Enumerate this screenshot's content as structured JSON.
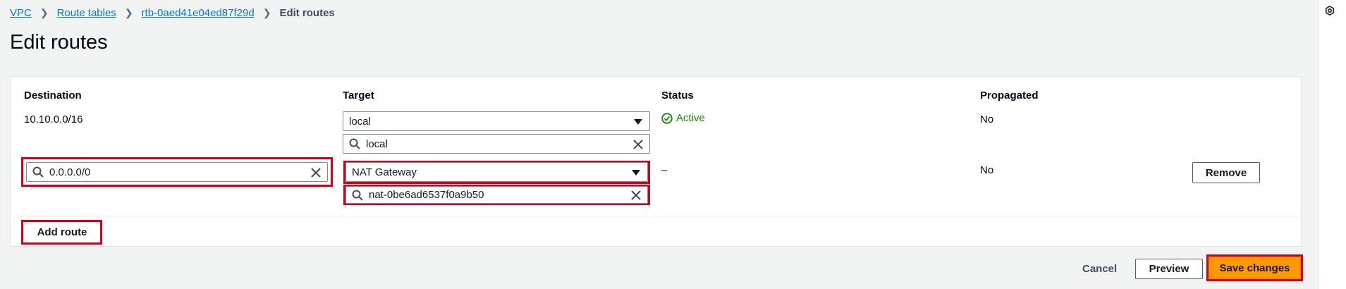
{
  "breadcrumb": {
    "items": [
      "VPC",
      "Route tables",
      "rtb-0aed41e04ed87f29d"
    ],
    "current": "Edit routes",
    "separator": ">"
  },
  "page": {
    "title": "Edit routes"
  },
  "table": {
    "headers": {
      "destination": "Destination",
      "target": "Target",
      "status": "Status",
      "propagated": "Propagated"
    },
    "rows": [
      {
        "destination": "10.10.0.0/16",
        "target_type": "local",
        "target_value": "local",
        "status": "Active",
        "propagated": "No"
      },
      {
        "destination": "0.0.0.0/0",
        "target_type": "NAT Gateway",
        "target_value": "nat-0be6ad6537f0a9b50",
        "status": "–",
        "propagated": "No",
        "remove_label": "Remove"
      }
    ]
  },
  "buttons": {
    "add_route": "Add route",
    "cancel": "Cancel",
    "preview": "Preview",
    "save": "Save changes"
  },
  "colors": {
    "link": "#0972d3",
    "primary": "#ff9900",
    "highlight": "#d0021b",
    "status_active": "#1d8102"
  },
  "icons": [
    "chevron-right-icon",
    "search-icon",
    "clear-icon",
    "caret-down-icon",
    "status-success-icon",
    "settings-icon"
  ]
}
